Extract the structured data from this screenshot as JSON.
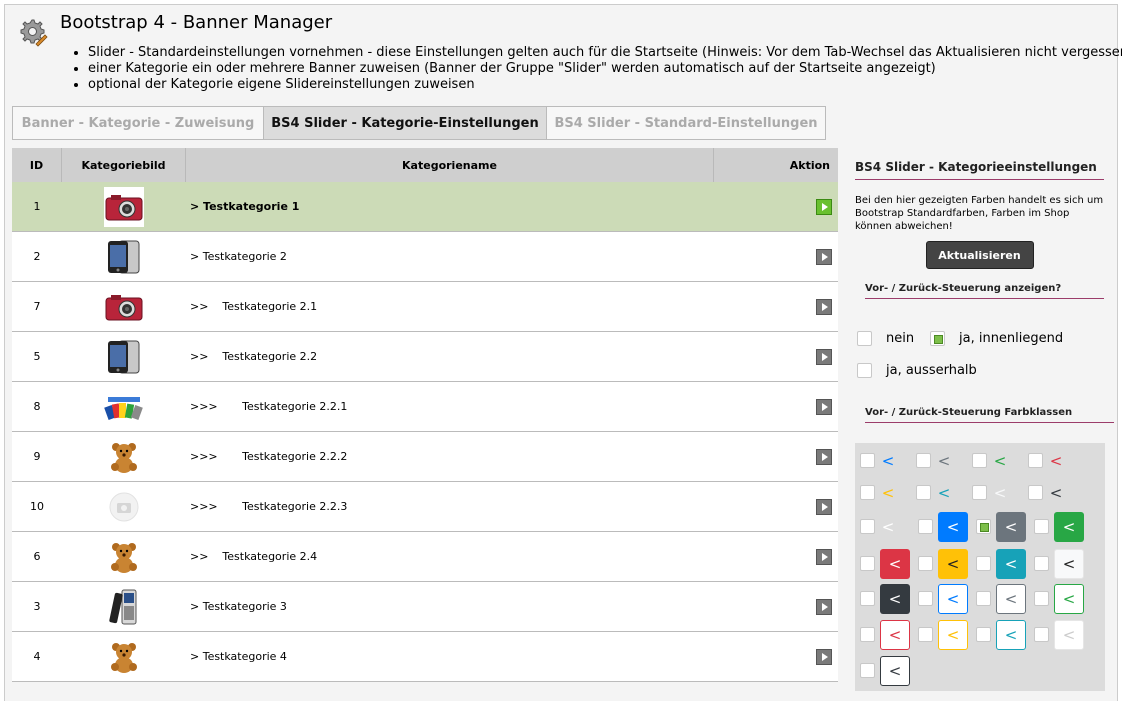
{
  "header": {
    "title": "Bootstrap 4 - Banner Manager",
    "bullets": [
      "Slider - Standardeinstellungen vornehmen - diese Einstellungen gelten auch für die Startseite (Hinweis: Vor dem Tab-Wechsel das Aktualisieren nicht vergessen!)",
      "einer Kategorie ein oder mehrere Banner zuweisen (Banner der Gruppe \"Slider\" werden automatisch auf der Startseite angezeigt)",
      "optional der Kategorie eigene Slidereinstellungen zuweisen"
    ]
  },
  "tabs": [
    {
      "label": "Banner - Kategorie - Zuweisung",
      "active": false
    },
    {
      "label": "BS4 Slider - Kategorie-Einstellungen",
      "active": true
    },
    {
      "label": "BS4 Slider - Standard-Einstellungen",
      "active": false
    }
  ],
  "table": {
    "headers": {
      "id": "ID",
      "image": "Kategoriebild",
      "name": "Kategoriename",
      "action": "Aktion"
    },
    "rows": [
      {
        "id": "1",
        "name": "> Testkategorie 1",
        "image": "camera-red",
        "selected": true
      },
      {
        "id": "2",
        "name": "> Testkategorie 2",
        "image": "phone-black",
        "selected": false
      },
      {
        "id": "7",
        "name": ">>    Testkategorie 2.1",
        "image": "camera-red",
        "selected": false
      },
      {
        "id": "5",
        "name": ">>    Testkategorie 2.2",
        "image": "phone-black",
        "selected": false
      },
      {
        "id": "8",
        "name": ">>>       Testkategorie 2.2.1",
        "image": "usb-sticks",
        "selected": false
      },
      {
        "id": "9",
        "name": ">>>       Testkategorie 2.2.2",
        "image": "teddy-bear",
        "selected": false
      },
      {
        "id": "10",
        "name": ">>>       Testkategorie 2.2.3",
        "image": "no-image",
        "selected": false
      },
      {
        "id": "6",
        "name": ">>    Testkategorie 2.4",
        "image": "teddy-bear",
        "selected": false
      },
      {
        "id": "3",
        "name": "> Testkategorie 3",
        "image": "mobile-phone",
        "selected": false
      },
      {
        "id": "4",
        "name": "> Testkategorie 4",
        "image": "teddy-bear",
        "selected": false
      }
    ]
  },
  "sidebar": {
    "title": "BS4 Slider - Kategorieeinstellungen",
    "info": "Bei den hier gezeigten Farben handelt es sich um Bootstrap Standardfarben, Farben im Shop können abweichen!",
    "update_button": "Aktualisieren",
    "controls_heading": "Vor- / Zurück-Steuerung anzeigen?",
    "controls_options": [
      {
        "label": "nein",
        "checked": false
      },
      {
        "label": "ja, innenliegend",
        "checked": true
      },
      {
        "label": "ja, ausserhalb",
        "checked": false
      }
    ],
    "colors_heading": "Vor- / Zurück-Steuerung Farbklassen",
    "arrow_glyph": "<",
    "swatches": [
      {
        "style": "text",
        "color": "#007bff",
        "checked": false
      },
      {
        "style": "text",
        "color": "#6c757d",
        "checked": false
      },
      {
        "style": "text",
        "color": "#28a745",
        "checked": false
      },
      {
        "style": "text",
        "color": "#dc3545",
        "checked": false
      },
      {
        "style": "text",
        "color": "#ffc107",
        "checked": false
      },
      {
        "style": "text",
        "color": "#17a2b8",
        "checked": false
      },
      {
        "style": "text",
        "color": "#f8f9fa",
        "checked": false
      },
      {
        "style": "text",
        "color": "#343a40",
        "checked": false
      },
      {
        "style": "text",
        "color": "#ffffff",
        "checked": false
      },
      {
        "style": "filled",
        "color": "#007bff",
        "checked": false
      },
      {
        "style": "filled",
        "color": "#6c757d",
        "checked": true
      },
      {
        "style": "filled",
        "color": "#28a745",
        "checked": false
      },
      {
        "style": "filled",
        "color": "#dc3545",
        "checked": false
      },
      {
        "style": "filled",
        "color": "#ffc107",
        "checked": false
      },
      {
        "style": "filled",
        "color": "#17a2b8",
        "checked": false
      },
      {
        "style": "filled",
        "color": "#f8f9fa",
        "checked": false
      },
      {
        "style": "filled",
        "color": "#343a40",
        "checked": false
      },
      {
        "style": "outline",
        "color": "#007bff",
        "checked": false
      },
      {
        "style": "outline",
        "color": "#6c757d",
        "checked": false
      },
      {
        "style": "outline",
        "color": "#28a745",
        "checked": false
      },
      {
        "style": "outline",
        "color": "#dc3545",
        "checked": false
      },
      {
        "style": "outline",
        "color": "#ffc107",
        "checked": false
      },
      {
        "style": "outline",
        "color": "#17a2b8",
        "checked": false
      },
      {
        "style": "outline",
        "color": "#f8f9fa",
        "checked": false
      },
      {
        "style": "outline",
        "color": "#343a40",
        "checked": false
      }
    ]
  }
}
